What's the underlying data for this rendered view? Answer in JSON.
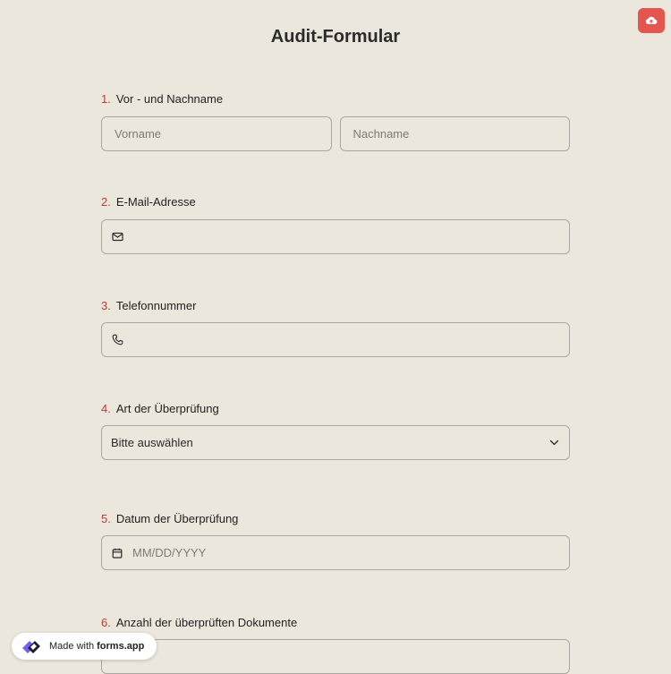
{
  "form": {
    "title": "Audit-Formular"
  },
  "questions": [
    {
      "number": "1.",
      "label": "Vor - und Nachname",
      "first_name_placeholder": "Vorname",
      "last_name_placeholder": "Nachname"
    },
    {
      "number": "2.",
      "label": "E-Mail-Adresse",
      "icon": "mail-icon"
    },
    {
      "number": "3.",
      "label": "Telefonnummer",
      "icon": "phone-icon"
    },
    {
      "number": "4.",
      "label": "Art der Überprüfung",
      "selected": "Bitte auswählen",
      "icon": "chevron-down-icon"
    },
    {
      "number": "5.",
      "label": "Datum der Überprüfung",
      "placeholder": "MM/DD/YYYY",
      "icon": "calendar-icon"
    },
    {
      "number": "6.",
      "label": "Anzahl der überprüften Dokumente"
    }
  ],
  "badge": {
    "prefix": "Made with",
    "brand": "forms.app"
  },
  "colors": {
    "background": "#ebe7dd",
    "accent": "#e5554f",
    "number": "#b0403a",
    "border": "#a9a79f"
  }
}
